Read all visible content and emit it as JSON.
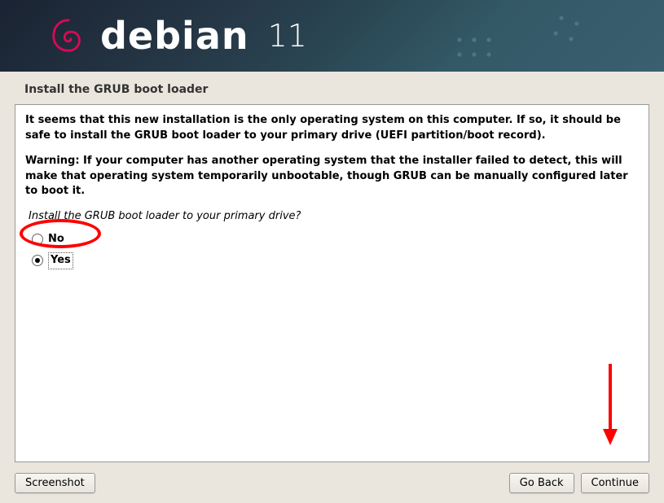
{
  "header": {
    "brand": "debian",
    "version": "11"
  },
  "title": "Install the GRUB boot loader",
  "body": {
    "paragraph1": "It seems that this new installation is the only operating system on this computer. If so, it should be safe to install the GRUB boot loader to your primary drive (UEFI partition/boot record).",
    "paragraph2": "Warning: If your computer has another operating system that the installer failed to detect, this will make that operating system temporarily unbootable, though GRUB can be manually configured later to boot it.",
    "question": "Install the GRUB boot loader to your primary drive?",
    "options": {
      "no": "No",
      "yes": "Yes"
    },
    "selected": "yes"
  },
  "footer": {
    "screenshot": "Screenshot",
    "go_back": "Go Back",
    "continue": "Continue"
  }
}
